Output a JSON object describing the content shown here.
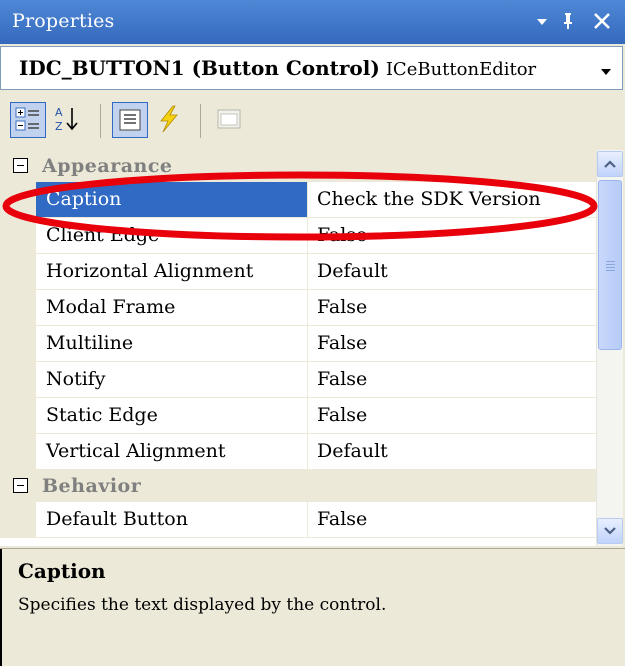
{
  "window": {
    "title": "Properties"
  },
  "selector": {
    "name": "IDC_BUTTON1 (Button Control)",
    "type": "ICeButtonEditor"
  },
  "toolbar": {
    "buttons": [
      "categorized-icon",
      "alphabetical-icon",
      "properties-icon",
      "events-icon",
      "property-pages-icon"
    ]
  },
  "grid": {
    "categories": [
      {
        "label": "Appearance",
        "rows": [
          {
            "name": "Caption",
            "value": "Check the SDK Version"
          },
          {
            "name": "Client Edge",
            "value": "False"
          },
          {
            "name": "Horizontal Alignment",
            "value": "Default"
          },
          {
            "name": "Modal Frame",
            "value": "False"
          },
          {
            "name": "Multiline",
            "value": "False"
          },
          {
            "name": "Notify",
            "value": "False"
          },
          {
            "name": "Static Edge",
            "value": "False"
          },
          {
            "name": "Vertical Alignment",
            "value": "Default"
          }
        ]
      },
      {
        "label": "Behavior",
        "rows": [
          {
            "name": "Default Button",
            "value": "False"
          }
        ]
      }
    ]
  },
  "description": {
    "title": "Caption",
    "text": "Specifies the text displayed by the control."
  },
  "colors": {
    "selection": "#316ac5",
    "annotation": "#e8000b",
    "titlebar": "#3d74c8"
  }
}
